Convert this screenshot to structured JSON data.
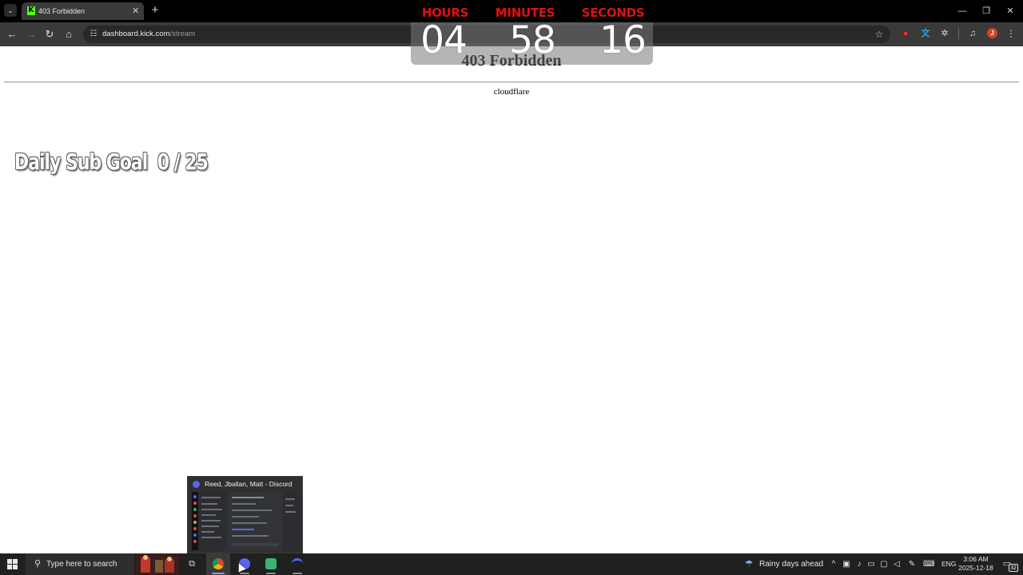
{
  "browser": {
    "tab_title": "403 Forbidden",
    "tab_close": "✕",
    "new_tab": "+",
    "url_host": "dashboard.kick.com",
    "url_path": "/stream",
    "window_minimize": "—",
    "window_restore": "❐",
    "window_close": "✕",
    "profile_initial": "J"
  },
  "page": {
    "heading": "403 Forbidden",
    "server": "cloudflare"
  },
  "countdown": {
    "hours_label": "HOURS",
    "minutes_label": "MINUTES",
    "seconds_label": "SECONDS",
    "hours": "04",
    "minutes": "58",
    "seconds": "16",
    "label_color": "#e01010"
  },
  "subgoal": {
    "label": "Daily Sub Goal",
    "count": "0 / 25"
  },
  "preview": {
    "title": "Reed, Jballan, Matt - Discord"
  },
  "taskbar": {
    "search_placeholder": "Type here to search",
    "weather": "Rainy days ahead",
    "language": "ENG",
    "time": "3:06 AM",
    "date": "2025-12-18",
    "notification_count": "32"
  },
  "icons": {
    "kick_favicon": "K",
    "tab_list": "chevron-down-icon",
    "back": "arrow-left-icon",
    "forward": "arrow-right-icon",
    "reload": "reload-icon",
    "home": "home-icon",
    "bookmark": "star-icon",
    "extensions": "puzzle-icon"
  }
}
